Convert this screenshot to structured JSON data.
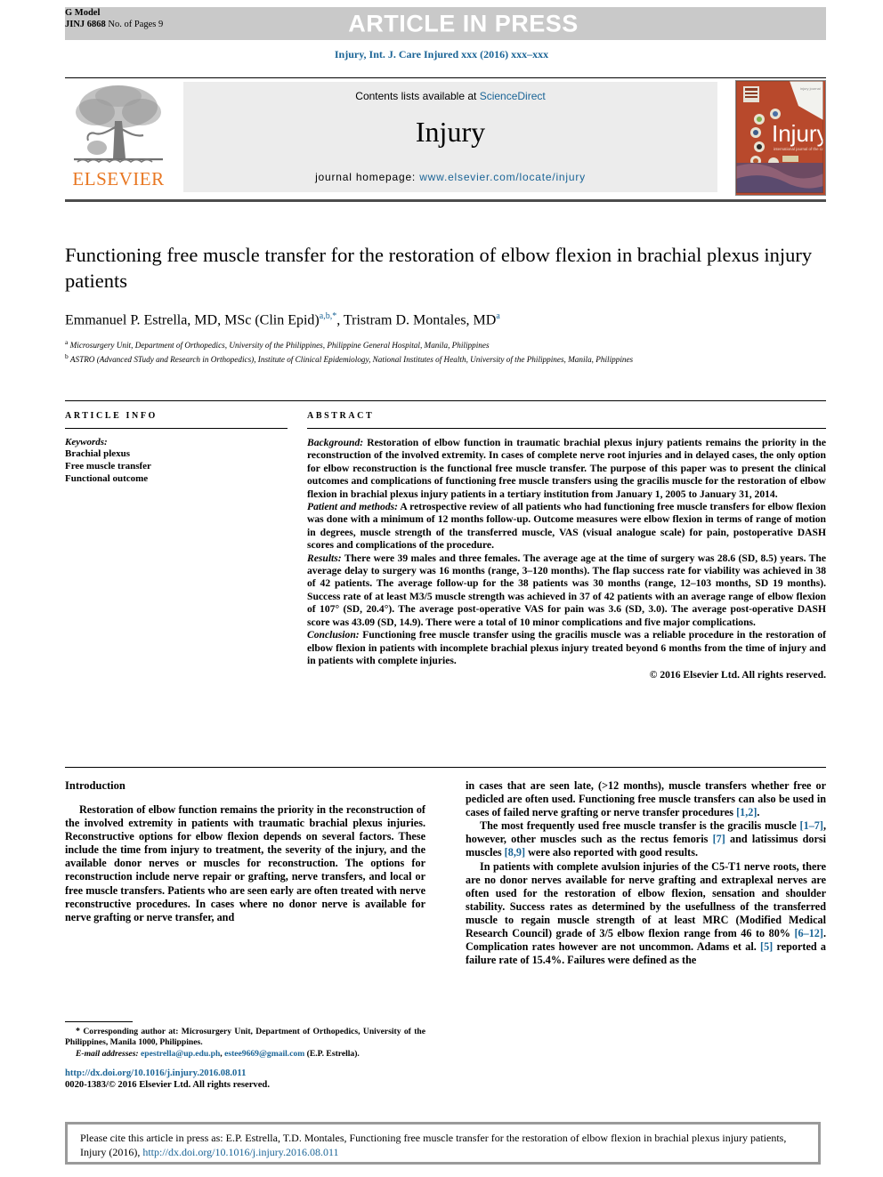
{
  "header": {
    "gmodel_line1": "G Model",
    "gmodel_line2_prefix": "JINJ 6868 ",
    "gmodel_line2_suffix": "No. of Pages 9",
    "press_banner": "ARTICLE IN PRESS",
    "journal_running_head": "Injury, Int. J. Care Injured xxx (2016) xxx–xxx"
  },
  "masthead": {
    "publisher_logo_text": "ELSEVIER",
    "contents_prefix": "Contents lists available at ",
    "contents_link": "ScienceDirect",
    "journal_name": "Injury",
    "homepage_prefix": "journal homepage: ",
    "homepage_link": "www.elsevier.com/locate/injury",
    "cover_title": "Injury",
    "cover_subtitle": "International Journal of the Care of the Injured"
  },
  "article": {
    "title": "Functioning free muscle transfer for the restoration of elbow flexion in brachial plexus injury patients",
    "authors_part1": "Emmanuel P. Estrella, MD, MSc (Clin Epid)",
    "authors_sup1": "a,b,*",
    "authors_part2": ", Tristram D. Montales, MD",
    "authors_sup2": "a",
    "affiliation_a_sup": "a",
    "affiliation_a": " Microsurgery Unit, Department of Orthopedics, University of the Philippines, Philippine General Hospital, Manila, Philippines",
    "affiliation_b_sup": "b",
    "affiliation_b": " ASTRO (Advanced STudy and Research in Orthopedics), Institute of Clinical Epidemiology, National Institutes of Health, University of the Philippines, Manila, Philippines"
  },
  "article_info": {
    "heading": "ARTICLE INFO",
    "keywords_label": "Keywords:",
    "keywords": [
      "Brachial plexus",
      "Free muscle transfer",
      "Functional outcome"
    ]
  },
  "abstract": {
    "heading": "ABSTRACT",
    "sections": [
      {
        "label": "Background:",
        "text": " Restoration of elbow function in traumatic brachial plexus injury patients remains the priority in the reconstruction of the involved extremity. In cases of complete nerve root injuries and in delayed cases, the only option for elbow reconstruction is the functional free muscle transfer. The purpose of this paper was to present the clinical outcomes and complications of functioning free muscle transfers using the gracilis muscle for the restoration of elbow flexion in brachial plexus injury patients in a tertiary institution from January 1, 2005 to January 31, 2014."
      },
      {
        "label": "Patient and methods:",
        "text": " A retrospective review of all patients who had functioning free muscle transfers for elbow flexion was done with a minimum of 12 months follow-up. Outcome measures were elbow flexion in terms of range of motion in degrees, muscle strength of the transferred muscle, VAS (visual analogue scale) for pain, postoperative DASH scores and complications of the procedure."
      },
      {
        "label": "Results:",
        "text": " There were 39 males and three females. The average age at the time of surgery was 28.6 (SD, 8.5) years. The average delay to surgery was 16 months (range, 3–120 months). The flap success rate for viability was achieved in 38 of 42 patients. The average follow-up for the 38 patients was 30 months (range, 12–103 months, SD 19 months). Success rate of at least M3/5 muscle strength was achieved in 37 of 42 patients with an average range of elbow flexion of 107° (SD, 20.4°). The average post-operative VAS for pain was 3.6 (SD, 3.0). The average post-operative DASH score was 43.09 (SD, 14.9). There were a total of 10 minor complications and five major complications."
      },
      {
        "label": "Conclusion:",
        "text": " Functioning free muscle transfer using the gracilis muscle was a reliable procedure in the restoration of elbow flexion in patients with incomplete brachial plexus injury treated beyond 6 months from the time of injury and in patients with complete injuries."
      }
    ],
    "copyright": "© 2016 Elsevier Ltd. All rights reserved."
  },
  "introduction": {
    "heading": "Introduction",
    "left_paragraph": "Restoration of elbow function remains the priority in the reconstruction of the involved extremity in patients with traumatic brachial plexus injuries. Reconstructive options for elbow flexion depends on several factors. These include the time from injury to treatment, the severity of the injury, and the available donor nerves or muscles for reconstruction. The options for reconstruction include nerve repair or grafting, nerve transfers, and local or free muscle transfers. Patients who are seen early are often treated with nerve reconstructive procedures. In cases where no donor nerve is available for nerve grafting or nerve transfer, and",
    "right_paragraph_1a": "in cases that are seen late, (>12 months), muscle transfers whether free or pedicled are often used. Functioning free muscle transfers can also be used in cases of failed nerve grafting or nerve transfer procedures ",
    "right_paragraph_1_ref": "[1,2]",
    "right_paragraph_1b": ".",
    "right_paragraph_2a": "The most frequently used free muscle transfer is the gracilis muscle ",
    "right_paragraph_2_ref1": "[1–7]",
    "right_paragraph_2b": ", however, other muscles such as the rectus femoris ",
    "right_paragraph_2_ref2": "[7]",
    "right_paragraph_2c": " and latissimus dorsi muscles ",
    "right_paragraph_2_ref3": "[8,9]",
    "right_paragraph_2d": " were also reported with good results.",
    "right_paragraph_3a": "In patients with complete avulsion injuries of the C5-T1 nerve roots, there are no donor nerves available for nerve grafting and extraplexal nerves are often used for the restoration of elbow flexion, sensation and shoulder stability. Success rates as determined by the usefullness of the transferred muscle to regain muscle strength of at least MRC (Modified Medical Research Council) grade of 3/5 elbow flexion range from 46 to 80% ",
    "right_paragraph_3_ref1": "[6–12]",
    "right_paragraph_3b": ". Complication rates however are not uncommon. Adams et al. ",
    "right_paragraph_3_ref2": "[5]",
    "right_paragraph_3c": " reported a failure rate of 15.4%. Failures were defined as the"
  },
  "footnote": {
    "star": "*",
    "corresponding": " Corresponding author at: Microsurgery Unit, Department of Orthopedics, University of the Philippines, Manila 1000, Philippines.",
    "email_label": "E-mail addresses:",
    "email1": "epestrella@up.edu.ph",
    "email_sep": ", ",
    "email2": "estee9669@gmail.com",
    "email_suffix": " (E.P. Estrella).",
    "doi_link": "http://dx.doi.org/10.1016/j.injury.2016.08.011",
    "issn_line": "0020-1383/© 2016 Elsevier Ltd. All rights reserved."
  },
  "citation_box": {
    "text_prefix": "Please cite this article in press as: E.P. Estrella, T.D. Montales, Functioning free muscle transfer for the restoration of elbow flexion in brachial plexus injury patients, Injury (2016), ",
    "link": "http://dx.doi.org/10.1016/j.injury.2016.08.011"
  },
  "colors": {
    "link_blue": "#1a6496",
    "elsevier_orange": "#E87722",
    "banner_gray": "#c9c9c9",
    "masthead_gray": "#ececec",
    "cite_border_gray": "#9a9a9a"
  }
}
